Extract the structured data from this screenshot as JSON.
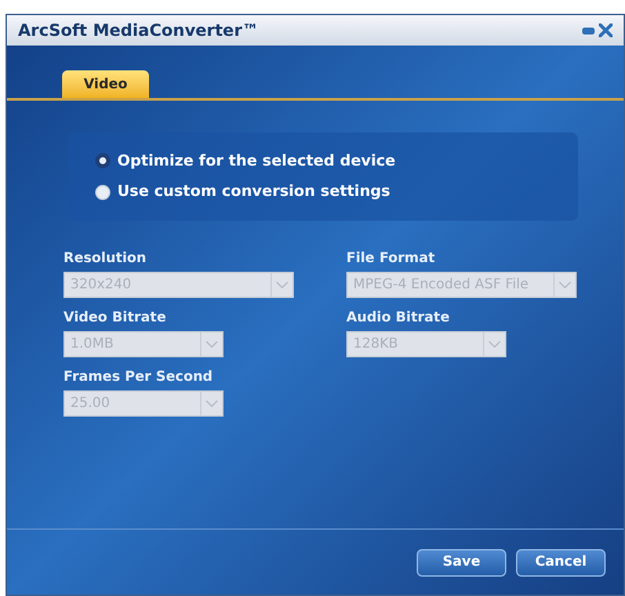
{
  "window": {
    "title": "ArcSoft MediaConverter™"
  },
  "tabs": [
    {
      "label": "Video",
      "selected": true
    }
  ],
  "options": [
    {
      "label": "Optimize for the selected device",
      "selected": true
    },
    {
      "label": "Use custom conversion settings",
      "selected": false
    }
  ],
  "fields": [
    {
      "kind": "wide",
      "label": "Resolution",
      "value": "320x240",
      "disabled": true
    },
    {
      "kind": "wide",
      "label": "File Format",
      "value": "MPEG-4 Encoded ASF File",
      "disabled": true
    },
    {
      "kind": "narrow",
      "label": "Video Bitrate",
      "value": "1.0MB",
      "disabled": true
    },
    {
      "kind": "narrow",
      "label": "Audio Bitrate",
      "value": "128KB",
      "disabled": true
    },
    {
      "kind": "narrow",
      "label": "Frames Per Second",
      "value": "25.00",
      "disabled": true
    }
  ],
  "buttons": [
    "Save",
    "Cancel"
  ]
}
